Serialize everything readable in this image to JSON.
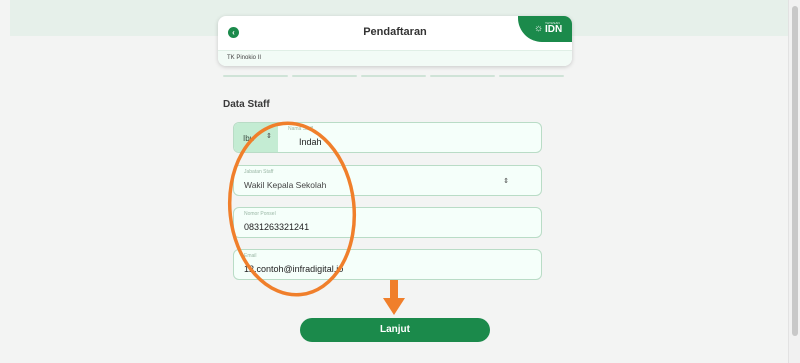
{
  "header": {
    "title": "Pendaftaran",
    "school": "TK Pinokio II",
    "brand_small": "YAYASAN",
    "brand_name": "IDN"
  },
  "progress": {
    "steps": 5
  },
  "section_title": "Data Staff",
  "form": {
    "name": {
      "prefix": "Ibu",
      "label": "Nama Staff",
      "value": "Indah"
    },
    "position": {
      "label": "Jabatan Staff",
      "value": "Wakil Kepala Sekolah"
    },
    "phone": {
      "label": "Nomor Ponsel",
      "value": "0831263321241"
    },
    "email": {
      "label": "Email",
      "value": "12.contoh@infradigital.io"
    }
  },
  "submit_label": "Lanjut",
  "icons": {
    "back": "chevron-left-icon",
    "brand": "sun-icon",
    "select": "up-down-chevron-icon",
    "annotation_arrow": "down-arrow-icon"
  },
  "colors": {
    "primary": "#1b8a4b",
    "annotation": "#f07f2b",
    "field_bg": "#f5fffa",
    "field_border": "#b9dcc6"
  }
}
